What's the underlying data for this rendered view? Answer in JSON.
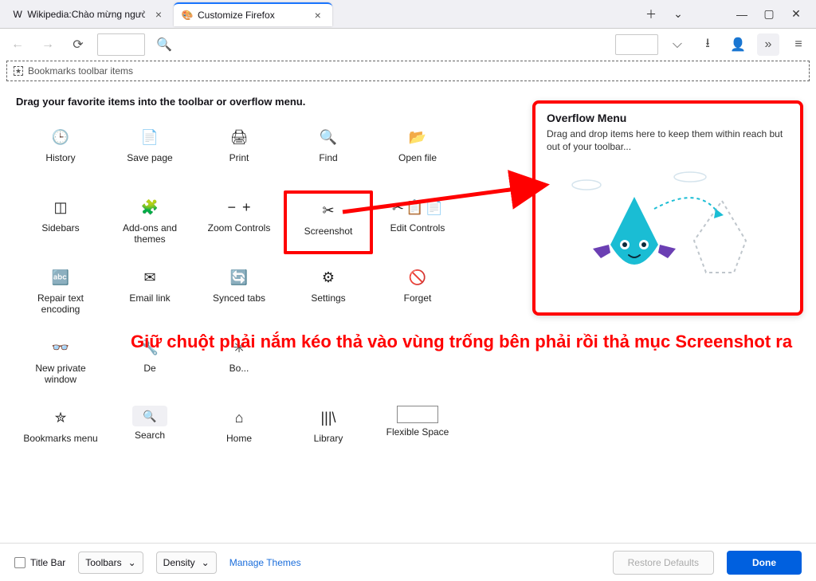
{
  "tabs": [
    {
      "title": "Wikipedia:Chào mừng người m",
      "favicon_letter": "W",
      "active": false
    },
    {
      "title": "Customize Firefox",
      "favicon_letter": "🎨",
      "active": true
    }
  ],
  "bookmarks_zone": "Bookmarks toolbar items",
  "heading": "Drag your favorite items into the toolbar or overflow menu.",
  "tiles": [
    [
      {
        "name": "history",
        "label": "History",
        "glyph": "🕒"
      },
      {
        "name": "save-page",
        "label": "Save page",
        "glyph": "📄"
      },
      {
        "name": "print",
        "label": "Print",
        "glyph": "🖨"
      },
      {
        "name": "find",
        "label": "Find",
        "glyph": "🔍"
      },
      {
        "name": "open-file",
        "label": "Open file",
        "glyph": "📂"
      }
    ],
    [
      {
        "name": "sidebars",
        "label": "Sidebars",
        "glyph": "◫"
      },
      {
        "name": "addons",
        "label": "Add-ons and themes",
        "glyph": "🧩"
      },
      {
        "name": "zoom",
        "label": "Zoom Controls",
        "glyph": "zoom"
      },
      {
        "name": "screenshot",
        "label": "Screenshot",
        "glyph": "✂",
        "highlight": true
      },
      {
        "name": "edit-controls",
        "label": "Edit Controls",
        "glyph": "edit"
      }
    ],
    [
      {
        "name": "repair-text",
        "label": "Repair text encoding",
        "glyph": "🔤"
      },
      {
        "name": "email-link",
        "label": "Email link",
        "glyph": "✉"
      },
      {
        "name": "synced-tabs",
        "label": "Synced tabs",
        "glyph": "🔄"
      },
      {
        "name": "settings",
        "label": "Settings",
        "glyph": "⚙"
      },
      {
        "name": "forget",
        "label": "Forget",
        "glyph": "🚫"
      }
    ],
    [
      {
        "name": "new-private",
        "label": "New private window",
        "glyph": "👓"
      },
      {
        "name": "dev-tools",
        "label": "De",
        "glyph": "🔧"
      },
      {
        "name": "bookmarks",
        "label": "Bo...",
        "glyph": "✳"
      }
    ],
    [
      {
        "name": "bookmarks-menu",
        "label": "Bookmarks menu",
        "glyph": "✮"
      },
      {
        "name": "search",
        "label": "Search",
        "glyph": "search-box"
      },
      {
        "name": "home",
        "label": "Home",
        "glyph": "⌂"
      },
      {
        "name": "library",
        "label": "Library",
        "glyph": "|||\\"
      },
      {
        "name": "flexible-space",
        "label": "Flexible Space",
        "glyph": "flex-space"
      }
    ]
  ],
  "overflow": {
    "title": "Overflow Menu",
    "desc": "Drag and drop items here to keep them within reach but out of your toolbar..."
  },
  "instruction": "Giữ chuột phải nắm kéo thả vào vùng trống bên phải rồi thả mục Screenshot ra",
  "footer": {
    "titlebar": "Title Bar",
    "toolbars": "Toolbars",
    "density": "Density",
    "manage_themes": "Manage Themes",
    "restore": "Restore Defaults",
    "done": "Done"
  }
}
